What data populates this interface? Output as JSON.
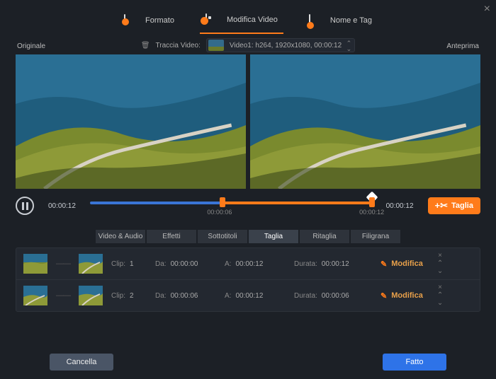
{
  "top_tabs": {
    "format": "Formato",
    "edit": "Modifica Video",
    "name_tag": "Nome e Tag"
  },
  "track": {
    "label": "Traccia Video:",
    "value": "Video1: h264, 1920x1080, 00:00:12"
  },
  "labels": {
    "original": "Originale",
    "preview": "Anteprima"
  },
  "playbar": {
    "time_left": "00:00:12",
    "time_right": "00:00:12",
    "sub_left": "00:00:06",
    "sub_right": "00:00:12",
    "cut": "Taglia"
  },
  "subtabs": [
    "Video & Audio",
    "Effetti",
    "Sottotitoli",
    "Taglia",
    "Ritaglia",
    "Filigrana"
  ],
  "clip_labels": {
    "clip": "Clip:",
    "from": "Da:",
    "to": "A:",
    "dur": "Durata:",
    "modify": "Modifica"
  },
  "clips": [
    {
      "n": "1",
      "from": "00:00:00",
      "to": "00:00:12",
      "dur": "00:00:12"
    },
    {
      "n": "2",
      "from": "00:00:06",
      "to": "00:00:12",
      "dur": "00:00:06"
    }
  ],
  "bottom": {
    "cancel": "Cancella",
    "done": "Fatto"
  }
}
